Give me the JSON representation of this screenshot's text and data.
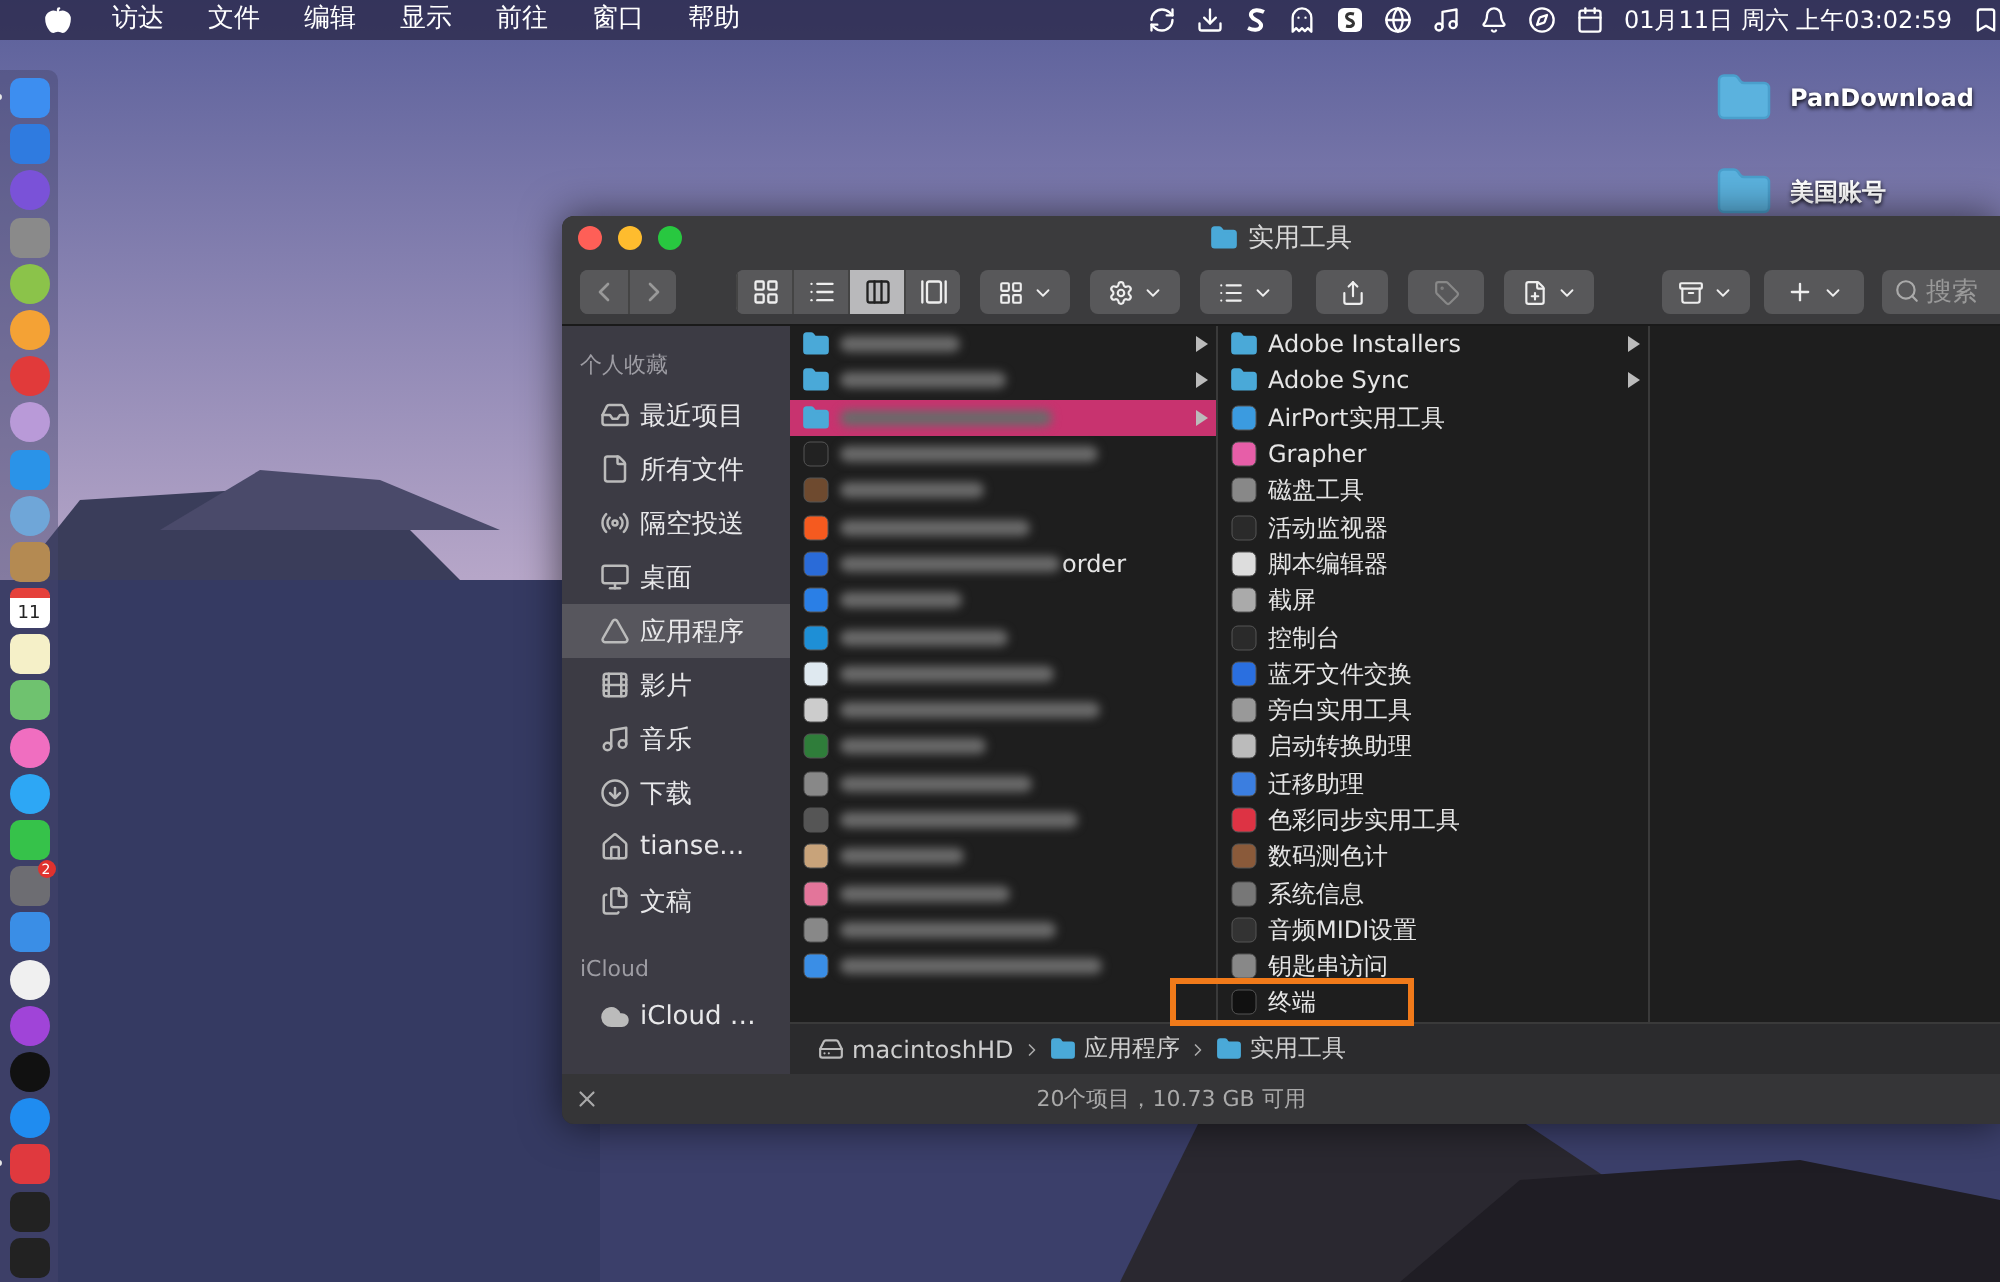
{
  "menu_bar": {
    "menus": [
      "访达",
      "文件",
      "编辑",
      "显示",
      "前往",
      "窗口",
      "帮助"
    ],
    "clock": "01月11日 周六 上午03:02:59"
  },
  "desktop_icons": [
    {
      "label": "PanDownload"
    },
    {
      "label": "美国账号"
    }
  ],
  "dock": [
    {
      "running": true
    },
    {
      "running": false
    },
    {
      "running": false
    },
    {
      "running": false
    },
    {
      "running": false
    },
    {
      "running": false
    },
    {
      "running": false
    },
    {
      "running": false
    },
    {
      "running": false
    },
    {
      "running": false
    },
    {
      "running": false
    },
    {
      "running": false,
      "label": "11"
    },
    {
      "running": false
    },
    {
      "running": false
    },
    {
      "running": false
    },
    {
      "running": false
    },
    {
      "running": false
    },
    {
      "running": false,
      "badge": "2"
    },
    {
      "running": false
    },
    {
      "running": false
    },
    {
      "running": false
    },
    {
      "running": false
    },
    {
      "running": false
    },
    {
      "running": true
    },
    {
      "running": false
    },
    {
      "running": false
    }
  ],
  "window": {
    "title": "实用工具",
    "toolbar": {
      "view_modes": [
        {
          "selected": false
        },
        {
          "selected": false
        },
        {
          "selected": true
        },
        {
          "selected": false
        }
      ],
      "search": {
        "placeholder": "搜索"
      }
    },
    "sidebar": [
      {
        "heading": "个人收藏",
        "items": [
          {
            "label": "最近项目",
            "selected": false
          },
          {
            "label": "所有文件",
            "selected": false
          },
          {
            "label": "隔空投送",
            "selected": false
          },
          {
            "label": "桌面",
            "selected": false
          },
          {
            "label": "应用程序",
            "selected": true
          },
          {
            "label": "影片",
            "selected": false
          },
          {
            "label": "音乐",
            "selected": false
          },
          {
            "label": "下载",
            "selected": false
          },
          {
            "label": "tianse...",
            "selected": false
          },
          {
            "label": "文稿",
            "selected": false
          }
        ]
      },
      {
        "heading": "iCloud",
        "items": [
          {
            "label": "iCloud …",
            "selected": false
          }
        ]
      }
    ],
    "column_1": [
      {
        "kind": "folder",
        "selected": false
      },
      {
        "kind": "folder",
        "selected": false
      },
      {
        "kind": "folder",
        "selected": true
      },
      {
        "kind": "app",
        "selected": false
      },
      {
        "kind": "app",
        "selected": false
      },
      {
        "kind": "app",
        "selected": false
      },
      {
        "kind": "app",
        "selected": false,
        "text": "order"
      },
      {
        "kind": "app",
        "selected": false
      },
      {
        "kind": "app",
        "selected": false
      },
      {
        "kind": "app",
        "selected": false
      },
      {
        "kind": "app",
        "selected": false
      },
      {
        "kind": "app",
        "selected": false
      },
      {
        "kind": "app",
        "selected": false
      },
      {
        "kind": "app",
        "selected": false
      },
      {
        "kind": "app",
        "selected": false
      },
      {
        "kind": "app",
        "selected": false
      },
      {
        "kind": "app",
        "selected": false
      },
      {
        "kind": "app",
        "selected": false
      }
    ],
    "column_2": [
      {
        "name": "Adobe Installers",
        "kind": "folder",
        "marked": false
      },
      {
        "name": "Adobe Sync",
        "kind": "folder",
        "marked": false
      },
      {
        "name": "AirPort实用工具",
        "kind": "app",
        "marked": false
      },
      {
        "name": "Grapher",
        "kind": "app",
        "marked": false
      },
      {
        "name": "磁盘工具",
        "kind": "app",
        "marked": false
      },
      {
        "name": "活动监视器",
        "kind": "app",
        "marked": false
      },
      {
        "name": "脚本编辑器",
        "kind": "app",
        "marked": false
      },
      {
        "name": "截屏",
        "kind": "app",
        "marked": false
      },
      {
        "name": "控制台",
        "kind": "app",
        "marked": false
      },
      {
        "name": "蓝牙文件交换",
        "kind": "app",
        "marked": false
      },
      {
        "name": "旁白实用工具",
        "kind": "app",
        "marked": false
      },
      {
        "name": "启动转换助理",
        "kind": "app",
        "marked": false
      },
      {
        "name": "迁移助理",
        "kind": "app",
        "marked": false
      },
      {
        "name": "色彩同步实用工具",
        "kind": "app",
        "marked": false
      },
      {
        "name": "数码测色计",
        "kind": "app",
        "marked": false
      },
      {
        "name": "系统信息",
        "kind": "app",
        "marked": false
      },
      {
        "name": "音频MIDI设置",
        "kind": "app",
        "marked": false
      },
      {
        "name": "钥匙串访问",
        "kind": "app",
        "marked": false
      },
      {
        "name": "终端",
        "kind": "app",
        "marked": true
      }
    ],
    "path_bar": [
      "macintoshHD",
      "应用程序",
      "实用工具"
    ],
    "status_bar": "20个项目，10.73 GB 可用"
  }
}
